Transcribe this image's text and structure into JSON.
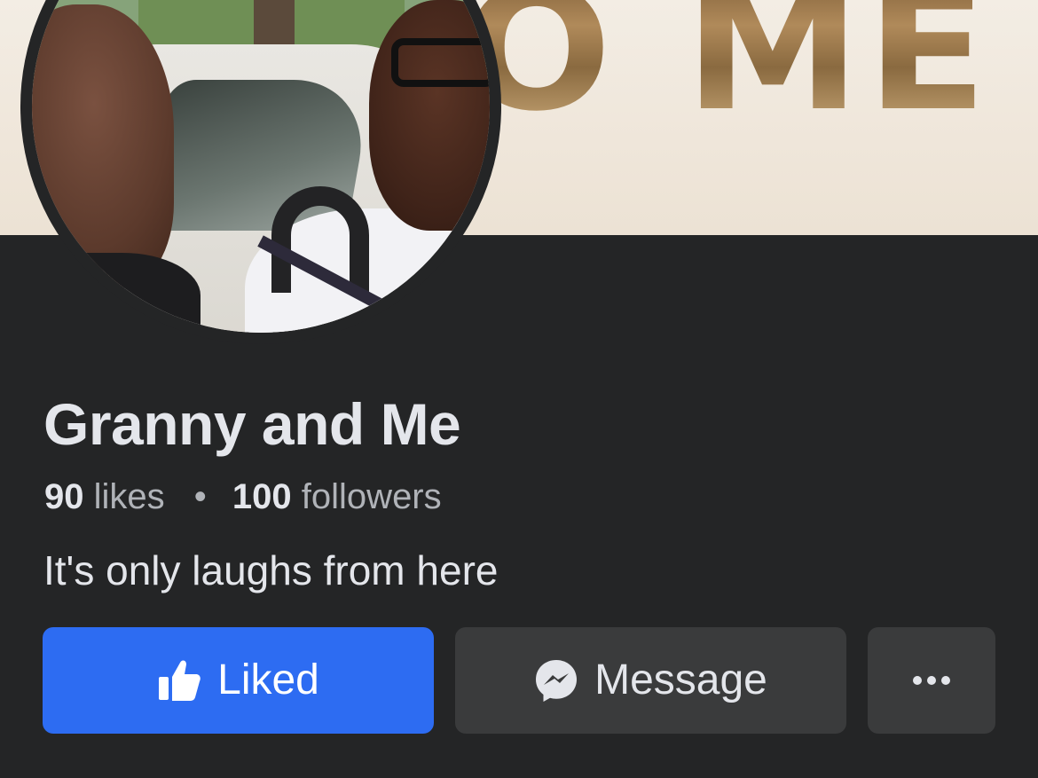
{
  "cover": {
    "text": "O ME"
  },
  "profile": {
    "name": "Granny and Me",
    "likes_count": "90",
    "likes_label": "likes",
    "separator": "•",
    "followers_count": "100",
    "followers_label": "followers",
    "bio": "It's only laughs from here"
  },
  "actions": {
    "liked_label": "Liked",
    "liked_icon": "thumbs-up-icon",
    "message_label": "Message",
    "message_icon": "messenger-icon",
    "more_icon": "more-options-icon"
  },
  "colors": {
    "background": "#242526",
    "primary_button": "#2d6cf2",
    "secondary_button": "#3a3b3c",
    "text_primary": "#e4e6eb",
    "text_secondary": "#b0b3b8"
  }
}
